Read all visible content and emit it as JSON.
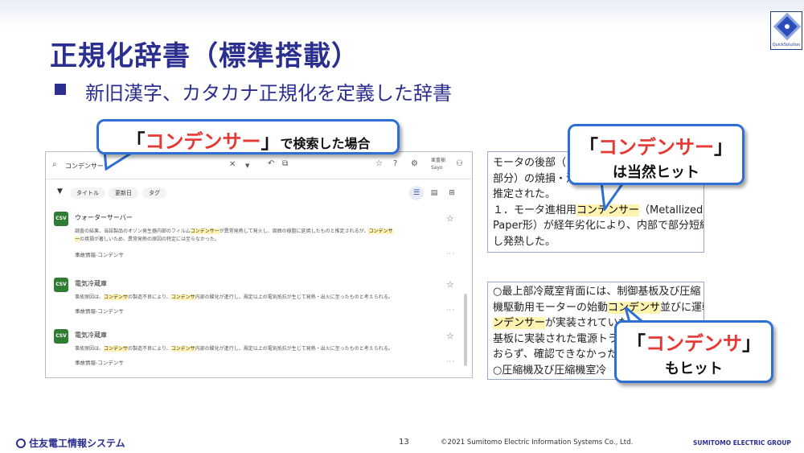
{
  "slide": {
    "title": "正規化辞書（標準搭載）",
    "subtitle": "新旧漢字、カタカナ正規化を定義した辞書",
    "logo_text": "QuickSolution",
    "page_number": "13",
    "copyright": "©2021 Sumitomo Electric Information Systems Co., Ltd.",
    "company": "住友電工情報システム",
    "group": "SUMITOMO ELECTRIC GROUP"
  },
  "callouts": {
    "search": {
      "open": "「",
      "term": "コンデンサー",
      "close": "」",
      "suffix": "で検索した場合"
    },
    "hit_exact": {
      "open": "「",
      "term": "コンデンサー",
      "close": "」",
      "line2": "は当然ヒット"
    },
    "hit_normalized": {
      "open": "「",
      "term": "コンデンサ",
      "close": "」",
      "line2": "もヒット"
    }
  },
  "search_ui": {
    "query": "コンデンサー",
    "user_name": "亜重樹",
    "user_sub": "Sayo",
    "filters": [
      "タイトル",
      "更新日",
      "タグ"
    ],
    "results": [
      {
        "badge": "CSV",
        "title": "ウォーターサーバー",
        "snippet_1a": "調査の結果、当該製品のオゾン発生器内部のフィルム",
        "snippet_1b": "コンデンサー",
        "snippet_1c": "が異常発熱して発火し、周囲の樹脂に延焼したものと推定されるが、",
        "snippet_1d": "コンデンサ",
        "snippet_2a": "ー",
        "snippet_2b": "の焼損が著しいため、異常発熱の原因の特定には至らなかった。",
        "tag": "事故情報-コンデンサ"
      },
      {
        "badge": "CSV",
        "title": "電気冷蔵庫",
        "snippet_a": "事故原因は、",
        "snippet_b": "コンデンサ",
        "snippet_c": "の製造不良により、",
        "snippet_d": "コンデンサ",
        "snippet_e": "内部の酸化が進行し、規定以上の電気抵抗が生じて発熱・出火に至ったものと考えられる。",
        "tag": "事故情報-コンデンサ"
      },
      {
        "badge": "CSV",
        "title": "電気冷蔵庫",
        "snippet_a": "事故原因は、",
        "snippet_b": "コンデンサ",
        "snippet_c": "の製造不良により、",
        "snippet_d": "コンデンサ",
        "snippet_e": "内部の酸化が進行し、規定以上の電気抵抗が生じて発熱・出火に至ったものと考えられる。",
        "tag": "事故情報-コンデンサ"
      }
    ]
  },
  "doc_excerpt_1": {
    "line1": "モータの後部（コ",
    "line2": "部分）の焼損・溶",
    "line3": "推定された。",
    "line4a": "１．モータ進相用",
    "line4b": "コンデンサー",
    "line4c": "（Metallized",
    "line5": "Paper形）が経年劣化により、内部で部分短絡",
    "line6": "し発熱した。"
  },
  "doc_excerpt_2": {
    "line1": "○最上部冷蔵室背面には、制御基板及び圧縮",
    "line2a": "機駆動用モーターの始動",
    "line2b": "コンデンサ",
    "line2c": "並びに運転",
    "line2d": "コ",
    "line3a": "ンデンサー",
    "line3b": "が実装されていたと",
    "line4": "基板に実装された電源トラン",
    "line5": "おらず、確認できなかった。",
    "line6": "○圧縮機及び圧縮機室冷"
  }
}
